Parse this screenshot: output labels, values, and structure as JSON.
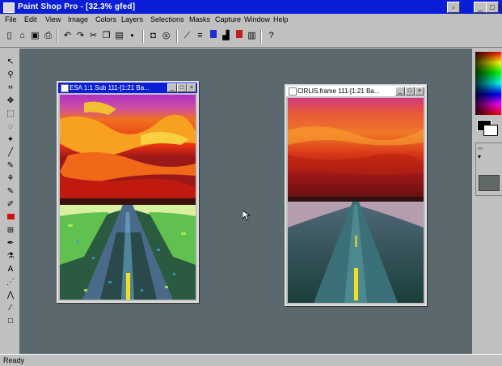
{
  "app": {
    "title": "Paint Shop Pro - [32.3% gfed]"
  },
  "menu": [
    "File",
    "Edit",
    "View",
    "Image",
    "Colors",
    "Layers",
    "Selections",
    "Masks",
    "Capture",
    "Window",
    "Help"
  ],
  "windows": [
    {
      "title": "ESA 1:1 Sub 111-[1:21 Ba...",
      "variant": "posterized"
    },
    {
      "title": "ClRLIS.frame 111-[1:21 Ba...",
      "variant": "smooth"
    }
  ],
  "status": {
    "left": "Ready",
    "right": ""
  },
  "colors": {
    "titlebar": "#0a1ed8",
    "workspace": "#5b696f",
    "active_title": "#0a1ed8",
    "inactive_title": "#ffffff"
  },
  "icons": {
    "toolbar": [
      "new-icon",
      "open-icon",
      "save-icon",
      "print-icon",
      "undo-icon",
      "redo-icon",
      "cut-icon",
      "copy-icon",
      "paste-icon",
      "zoom-icon",
      "color-icon",
      "histogram-icon",
      "layers-icon",
      "overview-icon",
      "tool-options-icon",
      "help-icon"
    ],
    "palette": [
      "arrow-icon",
      "zoom-tool-icon",
      "crop-icon",
      "mover-icon",
      "selection-icon",
      "freehand-icon",
      "magic-wand-icon",
      "dropper-icon",
      "paintbrush-icon",
      "clone-icon",
      "color-replacer-icon",
      "retouch-icon",
      "eraser-icon",
      "picture-tube-icon",
      "airbrush-icon",
      "flood-fill-icon",
      "text-icon",
      "line-icon",
      "shape-icon",
      "draw-icon"
    ]
  }
}
